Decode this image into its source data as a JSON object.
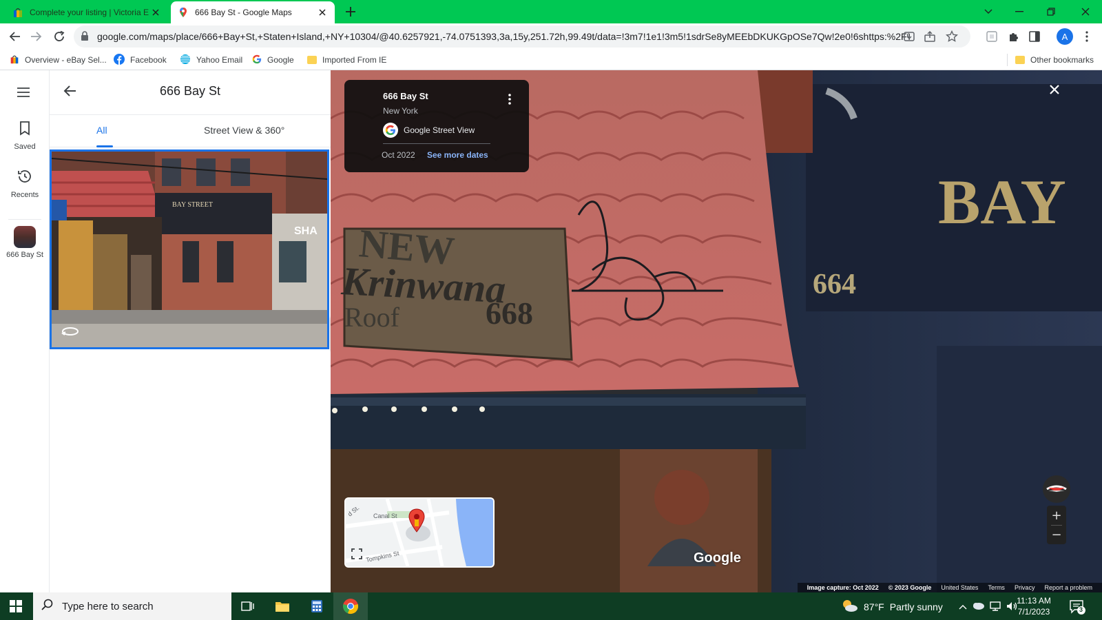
{
  "browser": {
    "tabs": [
      {
        "title": "Complete your listing | Victoria E",
        "favicon": "ebay-bag-icon",
        "active": false
      },
      {
        "title": "666 Bay St - Google Maps",
        "favicon": "maps-pin-icon",
        "active": true
      }
    ],
    "url": "google.com/maps/place/666+Bay+St,+Staten+Island,+NY+10304/@40.6257921,-74.0751393,3a,15y,251.72h,99.49t/data=!3m7!1e1!3m5!1sdrSe8yMEEbDKUKGpOSe7Qw!2e0!6shttps:%2F%2F...",
    "profile_initial": "A",
    "bookmarks": [
      {
        "label": "Overview - eBay Sel...",
        "icon": "ebay-bag-icon"
      },
      {
        "label": "Facebook",
        "icon": "facebook-icon"
      },
      {
        "label": "Yahoo Email",
        "icon": "att-globe-icon"
      },
      {
        "label": "Google",
        "icon": "google-g-icon"
      },
      {
        "label": "Imported From IE",
        "icon": "folder-icon"
      }
    ],
    "other_bookmarks": "Other bookmarks"
  },
  "rail": {
    "items": [
      {
        "label": "Saved",
        "icon": "bookmark-icon"
      },
      {
        "label": "Recents",
        "icon": "history-icon"
      },
      {
        "label": "666 Bay St",
        "icon": "place-thumbnail"
      }
    ]
  },
  "panel": {
    "title": "666 Bay St",
    "tabs": [
      "All",
      "Street View & 360°"
    ],
    "selected_tab": "All"
  },
  "streetview": {
    "card": {
      "name": "666 Bay St",
      "city": "New York",
      "source": "Google Street View",
      "date": "Oct 2022",
      "more_dates": "See more dates"
    },
    "minimap": {
      "streets": [
        "Canal St",
        "Tompkins St",
        "d St."
      ]
    },
    "watermark": "Google",
    "scene": {
      "sign_line1": "NEW",
      "sign_line2": "Krinwana",
      "sign_line3": "Roof",
      "sign_number": "668",
      "door_number": "664",
      "building_text": "BAY"
    },
    "attribution": {
      "capture": "Image capture: Oct 2022",
      "copyright": "© 2023 Google",
      "country": "United States",
      "terms": "Terms",
      "privacy": "Privacy",
      "report": "Report a problem"
    },
    "zoom_in": "+",
    "zoom_out": "−"
  },
  "taskbar": {
    "search_placeholder": "Type here to search",
    "weather_temp": "87°F",
    "weather_text": "Partly sunny",
    "time": "11:13 AM",
    "date": "7/1/2023",
    "notification_count": "3"
  },
  "colors": {
    "tabstrip": "#00c853",
    "taskbar": "#0e3d23",
    "accent": "#1a73e8"
  }
}
